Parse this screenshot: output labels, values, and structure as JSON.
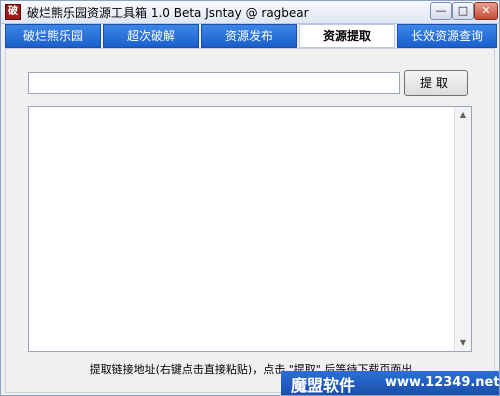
{
  "window": {
    "icon_glyph": "破",
    "title": "破烂熊乐园资源工具箱 1.0 Beta    Jsntay @ ragbear",
    "minimize_glyph": "—",
    "maximize_glyph": "□",
    "close_glyph": "✕"
  },
  "tabs": [
    {
      "label": "破烂熊乐园",
      "active": false
    },
    {
      "label": "超次破解",
      "active": false
    },
    {
      "label": "资源发布",
      "active": false
    },
    {
      "label": "资源提取",
      "active": true
    },
    {
      "label": "长效资源查询",
      "active": false
    }
  ],
  "extract": {
    "url_value": "",
    "fetch_label": "提取",
    "hint": "提取链接地址(右键点击直接粘贴)，点击 \"提取\" 后等待下载页面出"
  },
  "scrollbar": {
    "up_glyph": "▲",
    "down_glyph": "▼"
  },
  "watermark": {
    "name": "魔盟软件",
    "url": "www.12349.net"
  },
  "colors": {
    "tab_blue": "#1a5fcb",
    "watermark_blue": "#1b4fa8"
  }
}
